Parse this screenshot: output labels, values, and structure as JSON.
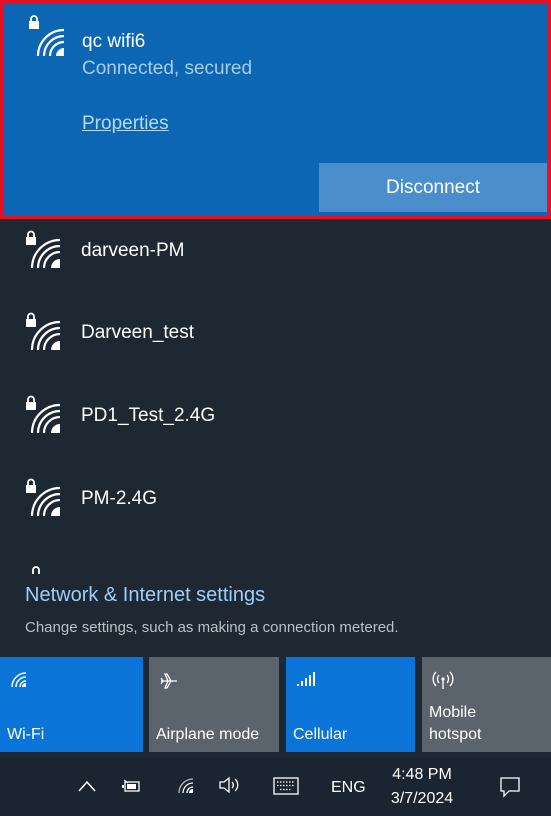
{
  "connected_network": {
    "name": "qc wifi6",
    "status": "Connected, secured",
    "properties_label": "Properties",
    "disconnect_label": "Disconnect"
  },
  "networks": [
    {
      "name": "darveen-PM",
      "secured": true
    },
    {
      "name": "Darveen_test",
      "secured": true
    },
    {
      "name": "PD1_Test_2.4G",
      "secured": true
    },
    {
      "name": "PM-2.4G",
      "secured": true
    }
  ],
  "settings": {
    "title": "Network & Internet settings",
    "subtitle": "Change settings, such as making a connection metered."
  },
  "quick_actions": [
    {
      "label": "Wi-Fi",
      "icon": "wifi-icon",
      "active": true
    },
    {
      "label": "Airplane mode",
      "icon": "airplane-icon",
      "active": false
    },
    {
      "label": "Cellular",
      "icon": "cellular-signal-icon",
      "active": true
    },
    {
      "label_line1": "Mobile",
      "label_line2": "hotspot",
      "icon": "hotspot-icon",
      "active": false
    }
  ],
  "taskbar": {
    "language": "ENG",
    "time": "4:48 PM",
    "date": "3/7/2024"
  },
  "colors": {
    "accent": "#0d66b3",
    "highlight_border": "#e81123",
    "panel_bg": "#1e2832"
  }
}
